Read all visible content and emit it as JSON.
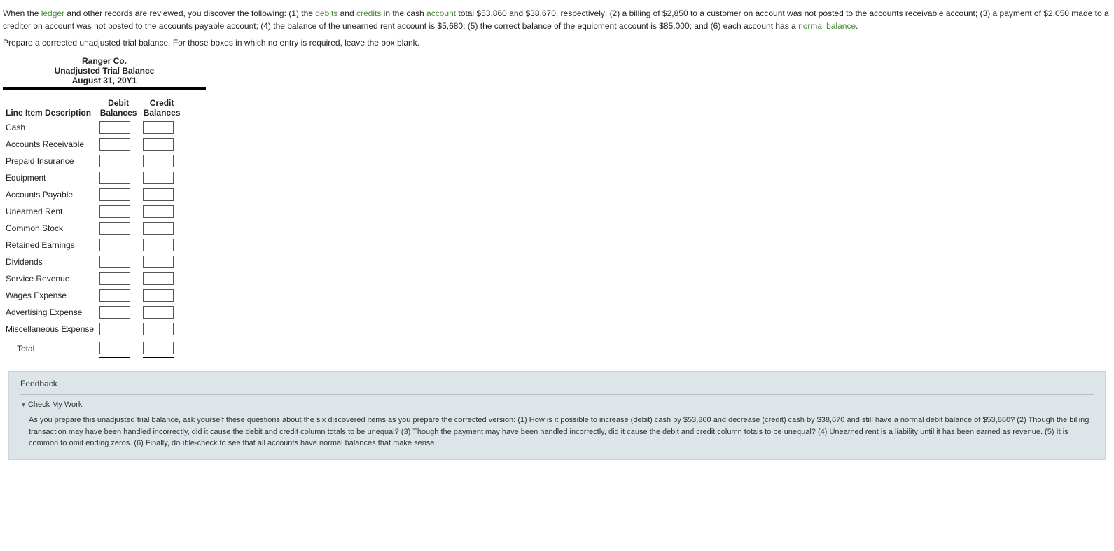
{
  "intro": {
    "p1_a": "When the ",
    "term_ledger": "ledger",
    "p1_b": " and other records are reviewed, you discover the following: (1) the ",
    "term_debits": "debits",
    "p1_c": " and ",
    "term_credits": "credits",
    "p1_d": " in the cash ",
    "term_account": "account",
    "p1_e": " total $53,860 and $38,670, respectively; (2) a billing of $2,850 to a customer on account was not posted to the accounts receivable account; (3) a payment of $2,050 made to a creditor on account was not posted to the accounts payable account; (4) the balance of the unearned rent account is $5,680; (5) the correct balance of the equipment account is $85,000; and (6) each account has a ",
    "term_normal": "normal balance",
    "p1_f": ".",
    "p2": "Prepare a corrected unadjusted trial balance. For those boxes in which no entry is required, leave the box blank."
  },
  "trial_balance": {
    "company": "Ranger Co.",
    "title": "Unadjusted Trial Balance",
    "date": "August 31, 20Y1",
    "col_desc": "Line Item Description",
    "col_debit": "Debit Balances",
    "col_credit": "Credit Balances",
    "rows": [
      {
        "label": "Cash",
        "debit": "",
        "credit": ""
      },
      {
        "label": "Accounts Receivable",
        "debit": "",
        "credit": ""
      },
      {
        "label": "Prepaid Insurance",
        "debit": "",
        "credit": ""
      },
      {
        "label": "Equipment",
        "debit": "",
        "credit": ""
      },
      {
        "label": "Accounts Payable",
        "debit": "",
        "credit": ""
      },
      {
        "label": "Unearned Rent",
        "debit": "",
        "credit": ""
      },
      {
        "label": "Common Stock",
        "debit": "",
        "credit": ""
      },
      {
        "label": "Retained Earnings",
        "debit": "",
        "credit": ""
      },
      {
        "label": "Dividends",
        "debit": "",
        "credit": ""
      },
      {
        "label": "Service Revenue",
        "debit": "",
        "credit": ""
      },
      {
        "label": "Wages Expense",
        "debit": "",
        "credit": ""
      },
      {
        "label": "Advertising Expense",
        "debit": "",
        "credit": ""
      },
      {
        "label": "Miscellaneous Expense",
        "debit": "",
        "credit": ""
      }
    ],
    "total_label": "Total",
    "total_debit": "",
    "total_credit": ""
  },
  "feedback": {
    "heading": "Feedback",
    "check": "Check My Work",
    "body": "As you prepare this unadjusted trial balance, ask yourself these questions about the six discovered items as you prepare the corrected version: (1) How is it possible to increase (debit) cash by $53,860 and decrease (credit) cash by $38,670 and still have a normal debit balance of $53,860? (2) Though the billing transaction may have been handled incorrectly, did it cause the debit and credit column totals to be unequal? (3) Though the payment may have been handled incorrectly, did it cause the debit and credit column totals to be unequal? (4) Unearned rent is a liability until it has been earned as revenue. (5) It is common to omit ending zeros. (6) Finally, double-check to see that all accounts have normal balances that make sense."
  }
}
